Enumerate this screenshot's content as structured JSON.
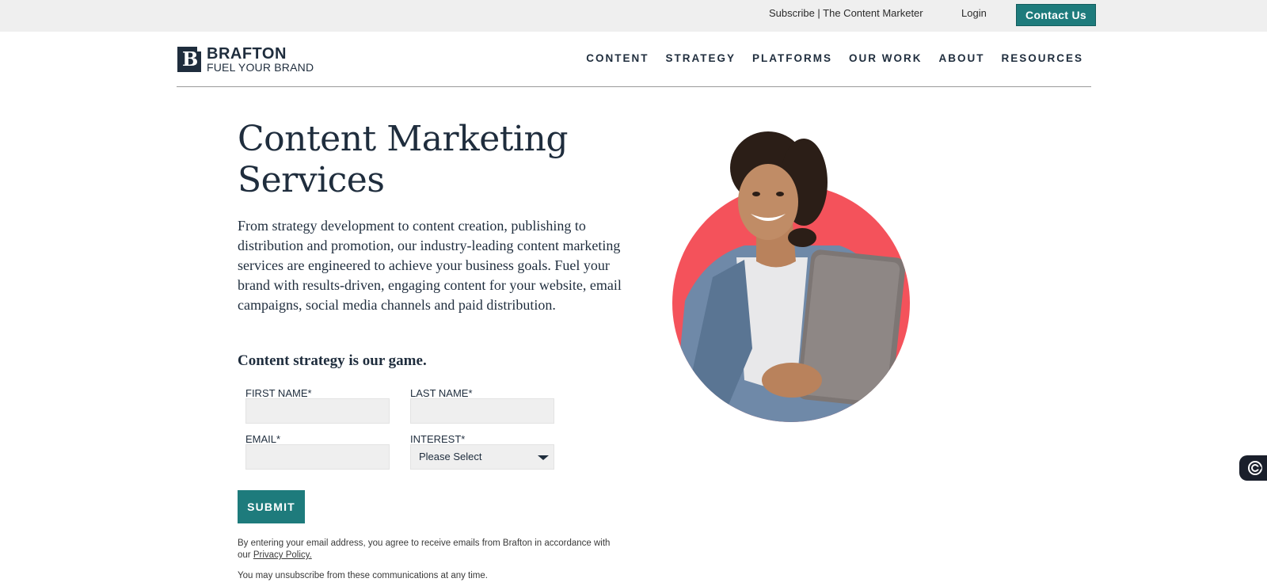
{
  "topbar": {
    "subscribe": "Subscribe | The Content Marketer",
    "login": "Login",
    "contact": "Contact Us"
  },
  "logo": {
    "mark": "B",
    "brand": "BRAFTON",
    "tagline": "FUEL YOUR BRAND"
  },
  "nav": {
    "items": [
      "CONTENT",
      "STRATEGY",
      "PLATFORMS",
      "OUR WORK",
      "ABOUT",
      "RESOURCES"
    ]
  },
  "hero": {
    "title": "Content Marketing Services",
    "intro": "From strategy development to content creation, publishing to distribution and promotion, our industry-leading content marketing services are engineered to achieve your business goals. Fuel your brand with results-driven, engaging content for your website, email campaigns, social media channels and paid distribution.",
    "subhead": "Content strategy is our game."
  },
  "form": {
    "first_name_label": "FIRST NAME*",
    "last_name_label": "LAST NAME*",
    "email_label": "EMAIL*",
    "interest_label": "INTEREST*",
    "interest_value": "Please Select",
    "submit": "SUBMIT",
    "legal_text": "By entering your email address, you agree to receive emails from Brafton in accordance with our ",
    "privacy_link": "Privacy Policy.",
    "unsubscribe": "You may unsubscribe from these communications at any time."
  },
  "colors": {
    "accent_teal": "#1e7b7c",
    "navy": "#1f2d3d",
    "circle_red": "#f4525b"
  },
  "icons": {
    "widget": "chat-widget-icon"
  }
}
